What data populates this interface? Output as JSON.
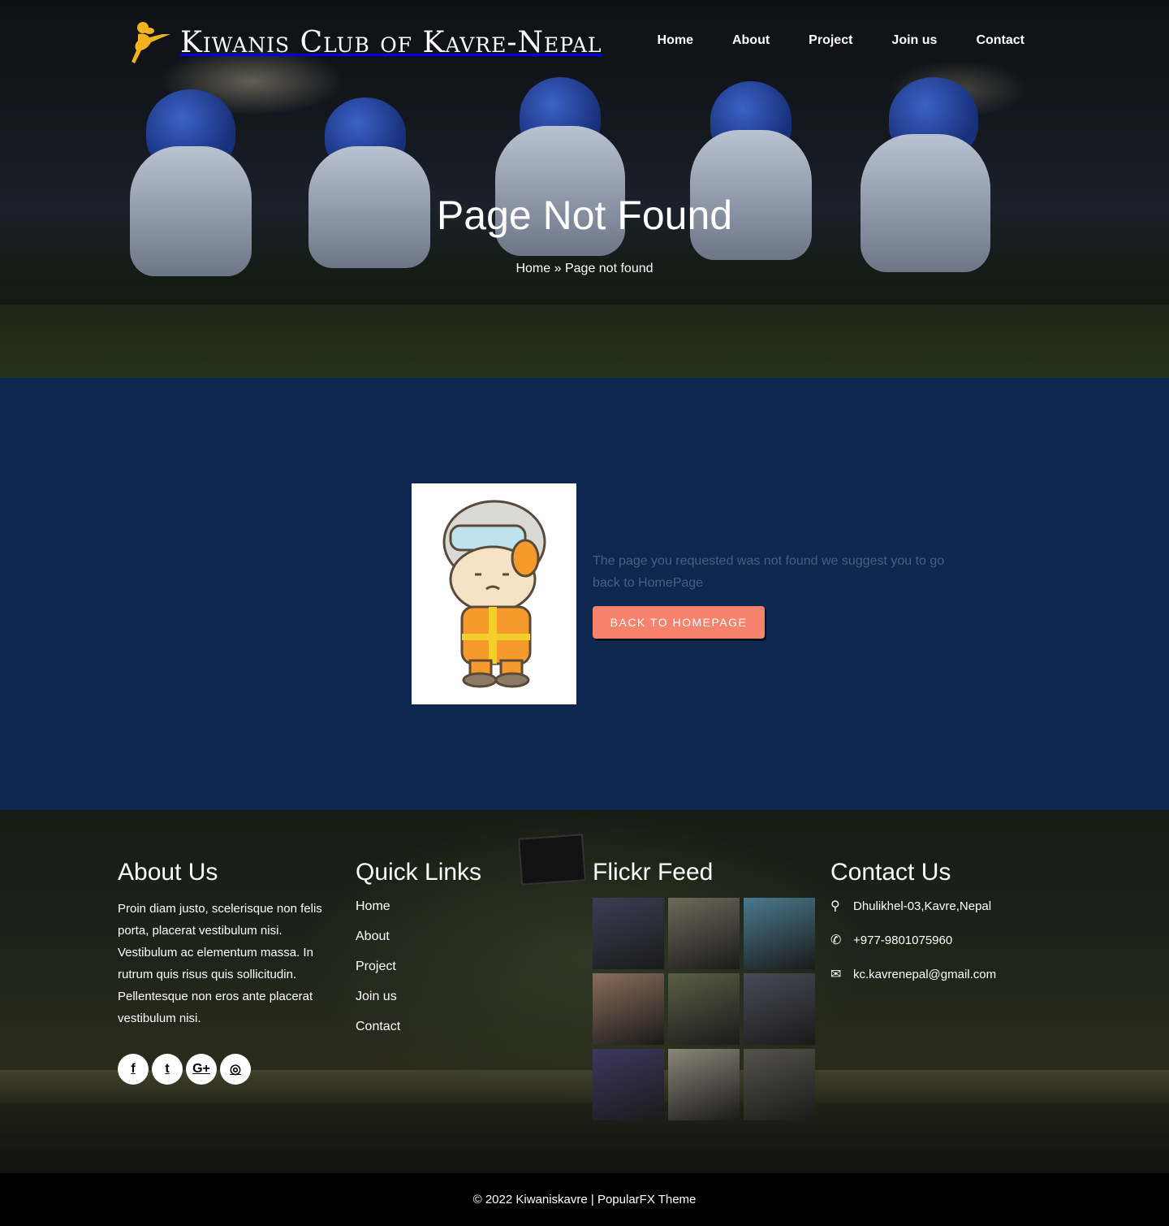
{
  "site": {
    "title": "Kiwanis Club of Kavre-Nepal"
  },
  "nav": {
    "items": [
      "Home",
      "About",
      "Project",
      "Join us",
      "Contact"
    ]
  },
  "hero": {
    "title": "Page Not Found",
    "breadcrumb_home": "Home",
    "breadcrumb_sep": "»",
    "breadcrumb_current": "Page not found"
  },
  "notfound": {
    "message": "The page you requested was not found we suggest you to go back to HomePage",
    "button": "Back to Homepage"
  },
  "footer": {
    "about_title": "About Us",
    "about_text": "Proin diam justo, scelerisque non felis porta, placerat vestibulum nisi. Vestibulum ac elementum massa. In rutrum quis risus quis sollicitudin. Pellentesque non eros ante placerat vestibulum nisi.",
    "social": [
      {
        "icon": "facebook-icon",
        "glyph": "f"
      },
      {
        "icon": "twitter-icon",
        "glyph": "t"
      },
      {
        "icon": "google-plus-icon",
        "glyph": "G+"
      },
      {
        "icon": "instagram-icon",
        "glyph": "◎"
      }
    ],
    "links_title": "Quick Links",
    "links": [
      "Home",
      "About",
      "Project",
      "Join us",
      "Contact"
    ],
    "flickr_title": "Flickr Feed",
    "flickr_colors": [
      "#3b3f55",
      "#6d6a5a",
      "#4a7a8f",
      "#8a6d5a",
      "#5a5f45",
      "#4a4a58",
      "#3d3860",
      "#8a8678",
      "#54534a"
    ],
    "contact_title": "Contact Us",
    "address": "Dhulikhel-03,Kavre,Nepal",
    "phone": "+977-9801075960",
    "email": "kc.kavrenepal@gmail.com"
  },
  "copyright": "© 2022 Kiwaniskavre | PopularFX Theme",
  "colors": {
    "accent": "#f7836d",
    "main_bg": "#0d2750",
    "logo": "#f2b21d"
  }
}
